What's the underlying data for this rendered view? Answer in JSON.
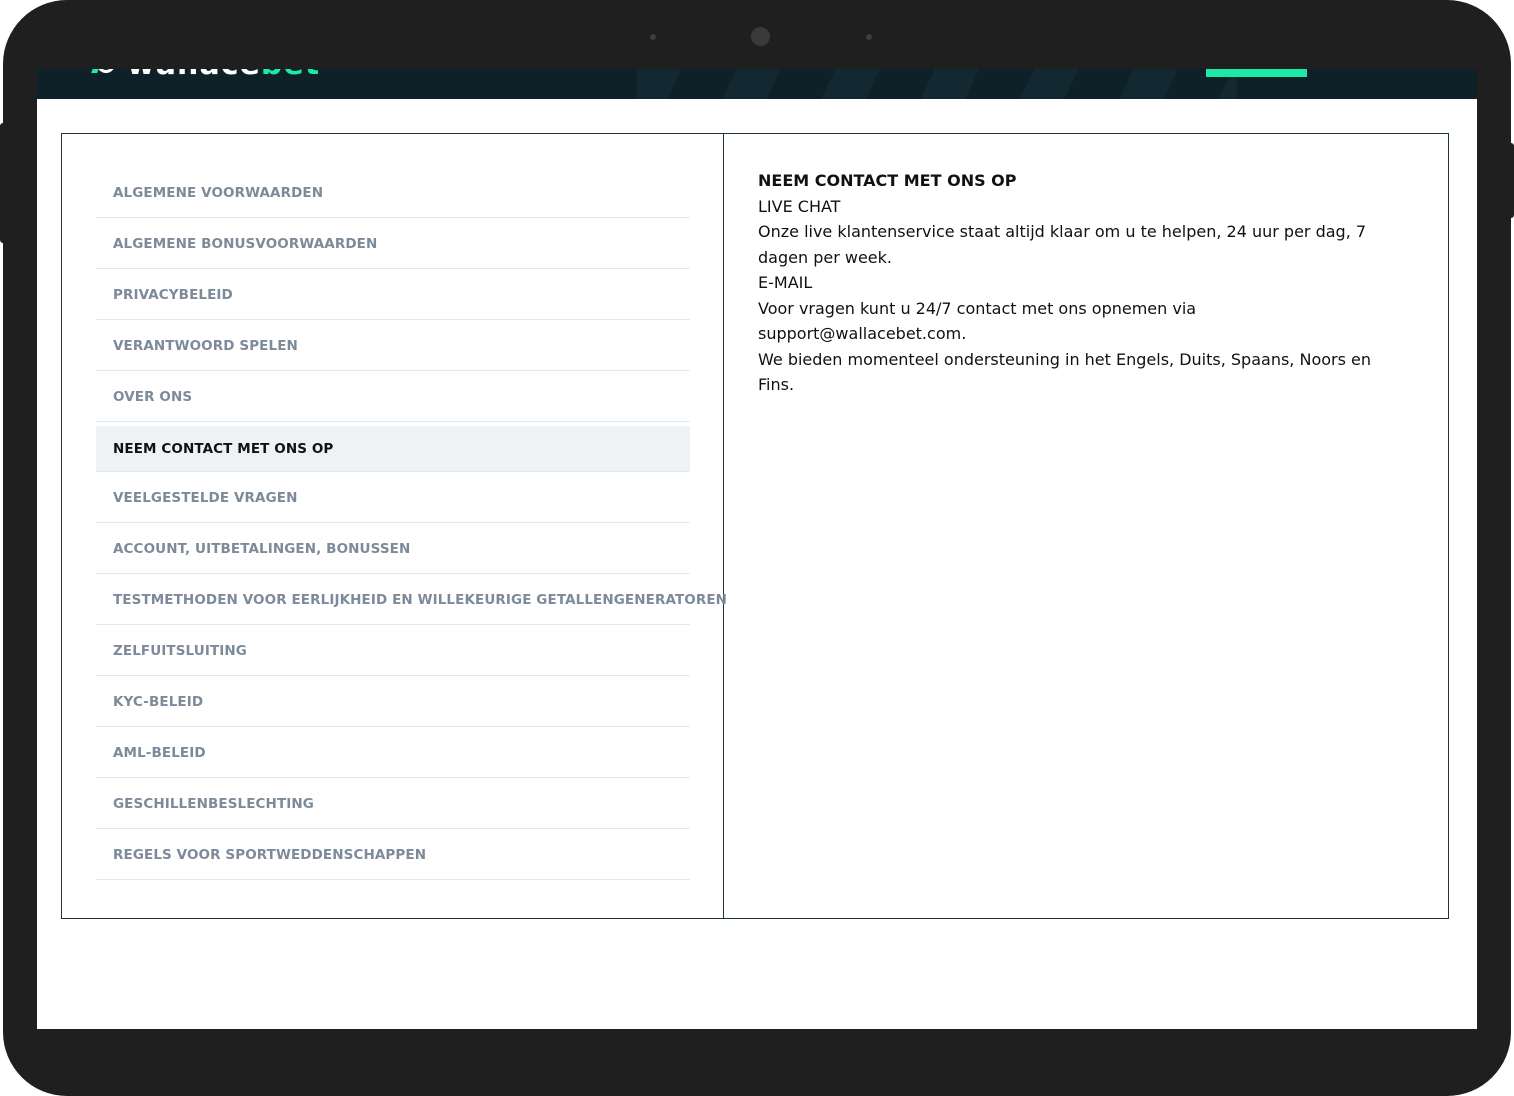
{
  "brand": {
    "name_part1": "wallace",
    "name_part2": "bet",
    "accent_color": "#1de9a6"
  },
  "sidebar": {
    "items": [
      {
        "label": "ALGEMENE VOORWAARDEN",
        "active": false
      },
      {
        "label": "ALGEMENE BONUSVOORWAARDEN",
        "active": false
      },
      {
        "label": "PRIVACYBELEID",
        "active": false
      },
      {
        "label": "VERANTWOORD SPELEN",
        "active": false
      },
      {
        "label": "OVER ONS",
        "active": false
      },
      {
        "label": "NEEM CONTACT MET ONS OP",
        "active": true
      },
      {
        "label": "VEELGESTELDE VRAGEN",
        "active": false
      },
      {
        "label": "ACCOUNT, UITBETALINGEN, BONUSSEN",
        "active": false
      },
      {
        "label": "TESTMETHODEN VOOR EERLIJKHEID EN WILLEKEURIGE GETALLENGENERATOREN",
        "active": false
      },
      {
        "label": "ZELFUITSLUITING",
        "active": false
      },
      {
        "label": "KYC-BELEID",
        "active": false
      },
      {
        "label": "AML-BELEID",
        "active": false
      },
      {
        "label": "GESCHILLENBESLECHTING",
        "active": false
      },
      {
        "label": "REGELS VOOR SPORTWEDDENSCHAPPEN",
        "active": false
      }
    ]
  },
  "content": {
    "heading": "NEEM CONTACT MET ONS OP",
    "live_chat_title": "LIVE CHAT",
    "live_chat_text": "Onze live klantenservice staat altijd klaar om u te helpen, 24 uur per dag, 7 dagen per week.",
    "email_title": "E-MAIL",
    "email_text": "Voor vragen kunt u 24/7 contact met ons opnemen via support@wallacebet.com.",
    "languages_text": "We bieden momenteel ondersteuning in het Engels, Duits, Spaans, Noors en Fins."
  }
}
